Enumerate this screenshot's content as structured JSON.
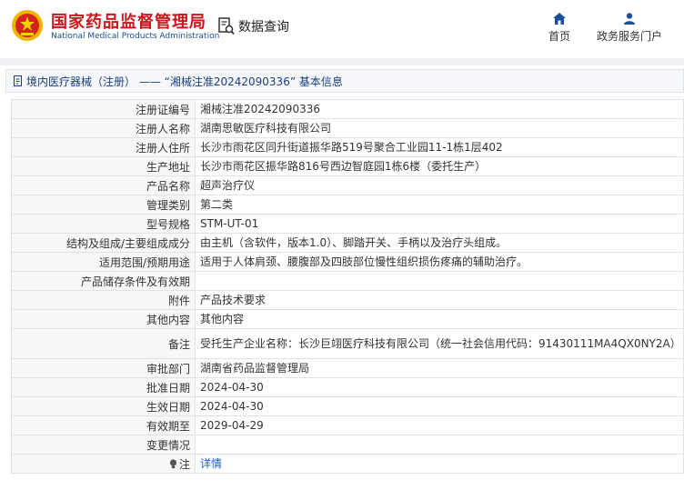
{
  "header": {
    "brand_cn": "国家药品监督管理局",
    "brand_en": "National Medical Products Administration",
    "search_label": "数据查询",
    "nav": {
      "home_label": "首页",
      "gov_label": "政务服务门户"
    }
  },
  "breadcrumb": {
    "text": "境内医疗器械（注册） —— “湘械注准20242090336” 基本信息"
  },
  "rows": [
    {
      "key": "注册证编号",
      "value": "湘械注准20242090336"
    },
    {
      "key": "注册人名称",
      "value": "湖南思敏医疗科技有限公司"
    },
    {
      "key": "注册人住所",
      "value": "长沙市雨花区同升街道振华路519号聚合工业园11-1栋1层402"
    },
    {
      "key": "生产地址",
      "value": "长沙市雨花区振华路816号西边智庭园1栋6楼（委托生产）"
    },
    {
      "key": "产品名称",
      "value": "超声治疗仪"
    },
    {
      "key": "管理类别",
      "value": "第二类"
    },
    {
      "key": "型号规格",
      "value": "STM-UT-01"
    },
    {
      "key": "结构及组成/主要组成成分",
      "value": "由主机（含软件，版本1.0）、脚踏开关、手柄以及治疗头组成。"
    },
    {
      "key": "适用范围/预期用途",
      "value": "适用于人体肩颈、腰腹部及四肢部位慢性组织损伤疼痛的辅助治疗。"
    },
    {
      "key": "产品储存条件及有效期",
      "value": ""
    },
    {
      "key": "附件",
      "value": "产品技术要求"
    },
    {
      "key": "其他内容",
      "value": "其他内容"
    },
    {
      "key": "备注",
      "value": "受托生产企业名称：长沙巨翊医疗科技有限公司（统一社会信用代码：91430111MA4QX0NY2A）"
    },
    {
      "key": "审批部门",
      "value": "湖南省药品监督管理局"
    },
    {
      "key": "批准日期",
      "value": "2024-04-30"
    },
    {
      "key": "生效日期",
      "value": "2024-04-30"
    },
    {
      "key": "有效期至",
      "value": "2029-04-29"
    },
    {
      "key": "变更情况",
      "value": ""
    },
    {
      "key": "注",
      "value": "详情"
    }
  ],
  "colors": {
    "brand_red": "#c8161d",
    "brand_blue": "#1b4e9c",
    "link_blue": "#1a5ec9"
  },
  "icons": [
    "emblem-logo",
    "search-doc-icon",
    "home-icon",
    "user-icon",
    "document-icon",
    "lightbulb-icon"
  ]
}
